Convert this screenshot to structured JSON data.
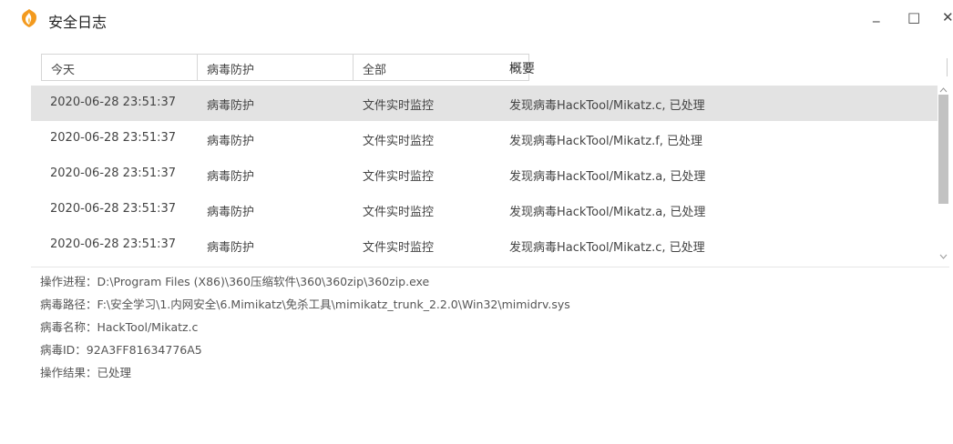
{
  "window": {
    "title": "安全日志",
    "icon": "shield-logo-icon",
    "controls": {
      "minimize": "_",
      "maximize": "□",
      "close": "✕"
    },
    "brand_color": "#f39a1e"
  },
  "filters": {
    "date": "今天",
    "category": "病毒防护",
    "source": "全部",
    "summary_header": "概要"
  },
  "log_rows": [
    {
      "time": "2020-06-28 23:51:37",
      "type": "病毒防护",
      "source": "文件实时监控",
      "summary": "发现病毒HackTool/Mikatz.c, 已处理"
    },
    {
      "time": "2020-06-28 23:51:37",
      "type": "病毒防护",
      "source": "文件实时监控",
      "summary": "发现病毒HackTool/Mikatz.f, 已处理"
    },
    {
      "time": "2020-06-28 23:51:37",
      "type": "病毒防护",
      "source": "文件实时监控",
      "summary": "发现病毒HackTool/Mikatz.a, 已处理"
    },
    {
      "time": "2020-06-28 23:51:37",
      "type": "病毒防护",
      "source": "文件实时监控",
      "summary": "发现病毒HackTool/Mikatz.a, 已处理"
    },
    {
      "time": "2020-06-28 23:51:37",
      "type": "病毒防护",
      "source": "文件实时监控",
      "summary": "发现病毒HackTool/Mikatz.c, 已处理"
    }
  ],
  "selected_row": 0,
  "details": {
    "process": "操作进程：D:\\Program Files (X86)\\360压缩软件\\360\\360zip\\360zip.exe",
    "virus_path": "病毒路径：F:\\安全学习\\1.内网安全\\6.Mimikatz\\免杀工具\\mimikatz_trunk_2.2.0\\Win32\\mimidrv.sys",
    "virus_name": "病毒名称：HackTool/Mikatz.c",
    "virus_id": "病毒ID：92A3FF81634776A5",
    "result": "操作结果：已处理"
  }
}
